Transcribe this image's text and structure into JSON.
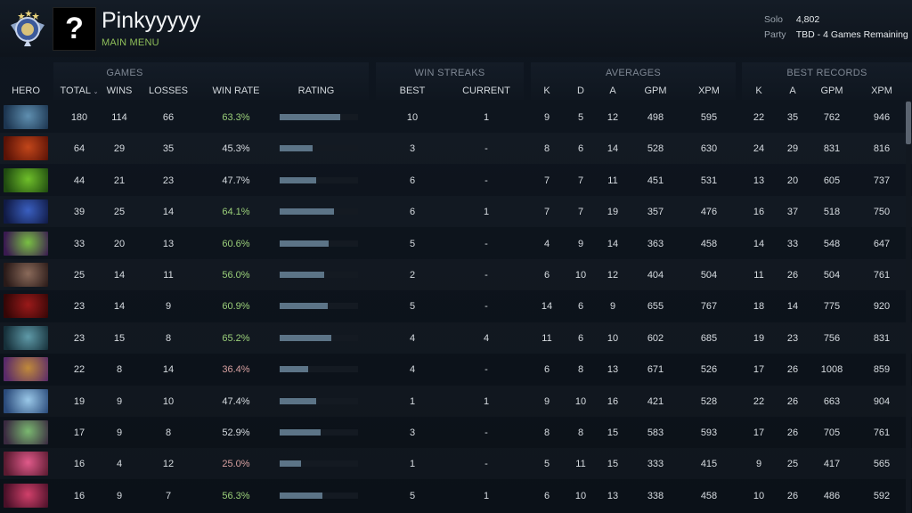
{
  "profile": {
    "username": "Pinkyyyyy",
    "main_menu_label": "MAIN MENU",
    "avatar_glyph": "?",
    "mmr": [
      {
        "label": "Solo",
        "value": "4,802"
      },
      {
        "label": "Party",
        "value": "TBD - 4 Games Remaining"
      }
    ]
  },
  "groups": {
    "games": "GAMES",
    "win_streaks": "WIN STREAKS",
    "averages": "AVERAGES",
    "best_records": "BEST RECORDS"
  },
  "columns": {
    "hero": "HERO",
    "total": "TOTAL",
    "sort_caret": "⌄",
    "wins": "WINS",
    "losses": "LOSSES",
    "win_rate": "WIN RATE",
    "rating": "RATING",
    "best": "BEST",
    "current": "CURRENT",
    "avg_k": "K",
    "avg_d": "D",
    "avg_a": "A",
    "avg_gpm": "GPM",
    "avg_xpm": "XPM",
    "best_k": "K",
    "best_a": "A",
    "best_gpm": "GPM",
    "best_xpm": "XPM"
  },
  "colors": {
    "win_rate_good": "#9bd07a",
    "win_rate_bad": "#d7a0a0",
    "rating_bar": "#5c7487",
    "main_menu": "#8fbf5a"
  },
  "rows": [
    {
      "portrait": [
        "#5f8fb0",
        "#1c3550"
      ],
      "total": "180",
      "wins": "114",
      "losses": "66",
      "win_rate": "63.3%",
      "rating": 0.77,
      "best": "10",
      "current": "1",
      "k": "9",
      "d": "5",
      "a": "12",
      "gpm": "498",
      "xpm": "595",
      "bk": "22",
      "ba": "35",
      "bgpm": "762",
      "bxpm": "946"
    },
    {
      "portrait": [
        "#c2461a",
        "#5a1206"
      ],
      "total": "64",
      "wins": "29",
      "losses": "35",
      "win_rate": "45.3%",
      "rating": 0.42,
      "best": "3",
      "current": "-",
      "k": "8",
      "d": "6",
      "a": "14",
      "gpm": "528",
      "xpm": "630",
      "bk": "24",
      "ba": "29",
      "bgpm": "831",
      "bxpm": "816"
    },
    {
      "portrait": [
        "#6fbf2a",
        "#1f4a10"
      ],
      "total": "44",
      "wins": "21",
      "losses": "23",
      "win_rate": "47.7%",
      "rating": 0.47,
      "best": "6",
      "current": "-",
      "k": "7",
      "d": "7",
      "a": "11",
      "gpm": "451",
      "xpm": "531",
      "bk": "13",
      "ba": "20",
      "bgpm": "605",
      "bxpm": "737"
    },
    {
      "portrait": [
        "#3a5fc0",
        "#101a45"
      ],
      "total": "39",
      "wins": "25",
      "losses": "14",
      "win_rate": "64.1%",
      "rating": 0.69,
      "best": "6",
      "current": "1",
      "k": "7",
      "d": "7",
      "a": "19",
      "gpm": "357",
      "xpm": "476",
      "bk": "16",
      "ba": "37",
      "bgpm": "518",
      "bxpm": "750"
    },
    {
      "portrait": [
        "#79c043",
        "#3a1a50"
      ],
      "total": "33",
      "wins": "20",
      "losses": "13",
      "win_rate": "60.6%",
      "rating": 0.63,
      "best": "5",
      "current": "-",
      "k": "4",
      "d": "9",
      "a": "14",
      "gpm": "363",
      "xpm": "458",
      "bk": "14",
      "ba": "33",
      "bgpm": "548",
      "bxpm": "647"
    },
    {
      "portrait": [
        "#8a6a5a",
        "#2a1a18"
      ],
      "total": "25",
      "wins": "14",
      "losses": "11",
      "win_rate": "56.0%",
      "rating": 0.57,
      "best": "2",
      "current": "-",
      "k": "6",
      "d": "10",
      "a": "12",
      "gpm": "404",
      "xpm": "504",
      "bk": "11",
      "ba": "26",
      "bgpm": "504",
      "bxpm": "761"
    },
    {
      "portrait": [
        "#9a1a1a",
        "#350606"
      ],
      "total": "23",
      "wins": "14",
      "losses": "9",
      "win_rate": "60.9%",
      "rating": 0.61,
      "best": "5",
      "current": "-",
      "k": "14",
      "d": "6",
      "a": "9",
      "gpm": "655",
      "xpm": "767",
      "bk": "18",
      "ba": "14",
      "bgpm": "775",
      "bxpm": "920"
    },
    {
      "portrait": [
        "#5f9aa8",
        "#16303a"
      ],
      "total": "23",
      "wins": "15",
      "losses": "8",
      "win_rate": "65.2%",
      "rating": 0.66,
      "best": "4",
      "current": "4",
      "k": "11",
      "d": "6",
      "a": "10",
      "gpm": "602",
      "xpm": "685",
      "bk": "19",
      "ba": "23",
      "bgpm": "756",
      "bxpm": "831"
    },
    {
      "portrait": [
        "#c08a3a",
        "#5a2a6a"
      ],
      "total": "22",
      "wins": "8",
      "losses": "14",
      "win_rate": "36.4%",
      "rating": 0.36,
      "best": "4",
      "current": "-",
      "k": "6",
      "d": "8",
      "a": "13",
      "gpm": "671",
      "xpm": "526",
      "bk": "17",
      "ba": "26",
      "bgpm": "1008",
      "bxpm": "859"
    },
    {
      "portrait": [
        "#9ac8e8",
        "#2a4a7a"
      ],
      "total": "19",
      "wins": "9",
      "losses": "10",
      "win_rate": "47.4%",
      "rating": 0.47,
      "best": "1",
      "current": "1",
      "k": "9",
      "d": "10",
      "a": "16",
      "gpm": "421",
      "xpm": "528",
      "bk": "22",
      "ba": "26",
      "bgpm": "663",
      "bxpm": "904"
    },
    {
      "portrait": [
        "#7ab870",
        "#3a2a40"
      ],
      "total": "17",
      "wins": "9",
      "losses": "8",
      "win_rate": "52.9%",
      "rating": 0.52,
      "best": "3",
      "current": "-",
      "k": "8",
      "d": "8",
      "a": "15",
      "gpm": "583",
      "xpm": "593",
      "bk": "17",
      "ba": "26",
      "bgpm": "705",
      "bxpm": "761"
    },
    {
      "portrait": [
        "#e05a8a",
        "#5a1a30"
      ],
      "total": "16",
      "wins": "4",
      "losses": "12",
      "win_rate": "25.0%",
      "rating": 0.27,
      "best": "1",
      "current": "-",
      "k": "5",
      "d": "11",
      "a": "15",
      "gpm": "333",
      "xpm": "415",
      "bk": "9",
      "ba": "25",
      "bgpm": "417",
      "bxpm": "565"
    },
    {
      "portrait": [
        "#d0406a",
        "#4a1028"
      ],
      "total": "16",
      "wins": "9",
      "losses": "7",
      "win_rate": "56.3%",
      "rating": 0.54,
      "best": "5",
      "current": "1",
      "k": "6",
      "d": "10",
      "a": "13",
      "gpm": "338",
      "xpm": "458",
      "bk": "10",
      "ba": "26",
      "bgpm": "486",
      "bxpm": "592"
    }
  ]
}
